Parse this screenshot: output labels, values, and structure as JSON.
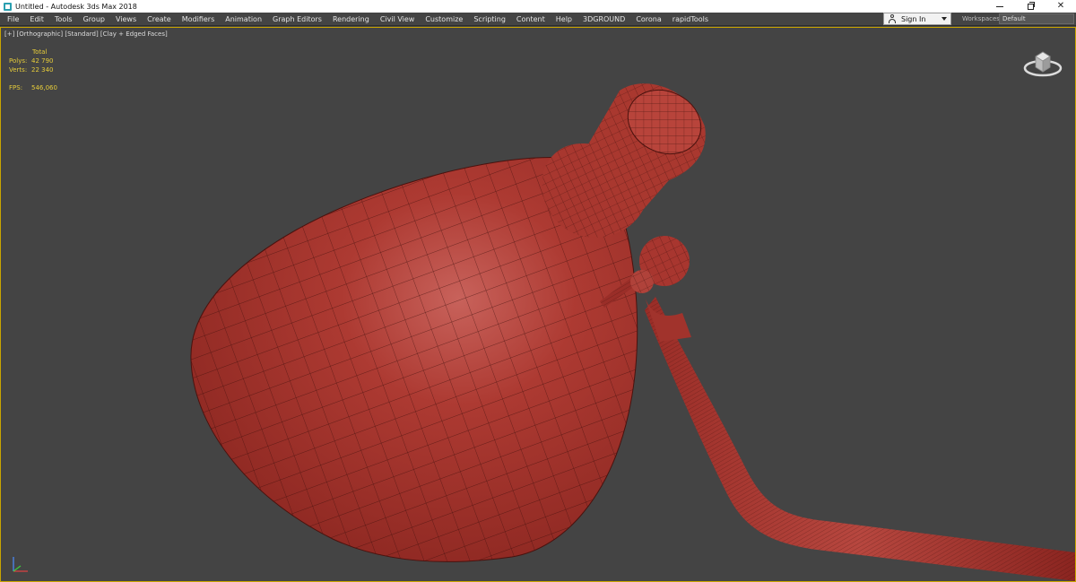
{
  "window": {
    "title": "Untitled - Autodesk 3ds Max 2018",
    "minimize_icon": "minimize-icon",
    "maximize_icon": "restore-icon",
    "close_glyph": "✕"
  },
  "menu": [
    "File",
    "Edit",
    "Tools",
    "Group",
    "Views",
    "Create",
    "Modifiers",
    "Animation",
    "Graph Editors",
    "Rendering",
    "Civil View",
    "Customize",
    "Scripting",
    "Content",
    "Help",
    "3DGROUND",
    "Corona",
    "rapidTools"
  ],
  "signin": {
    "label": "Sign In",
    "icon": "user-icon"
  },
  "workspaces": {
    "label": "Workspaces:",
    "value": "Default"
  },
  "viewport": {
    "label": "[+] [Orthographic] [Standard] [Clay + Edged Faces]",
    "stats": {
      "header": "Total",
      "polys_label": "Polys:",
      "polys_value": "42 790",
      "verts_label": "Verts:",
      "verts_value": "22 340",
      "fps_label": "FPS:",
      "fps_value": "546,060"
    },
    "border_color": "#c9a400",
    "model_color": "#b23a32"
  }
}
